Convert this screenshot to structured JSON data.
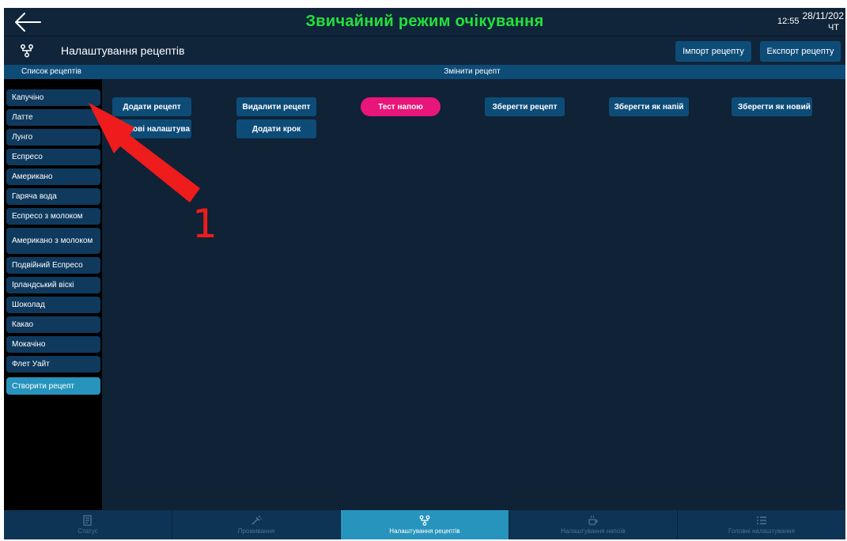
{
  "header": {
    "mode_title": "Звичайний режим очікування",
    "time": "12:55",
    "date": "28/11/202",
    "weekday": "ЧТ"
  },
  "section": {
    "title": "Налаштування рецептів",
    "icon": "recipe-settings-icon",
    "import_label": "Імпорт рецепту",
    "export_label": "Експорт рецепту"
  },
  "subheader": {
    "list_label": "Список рецептів",
    "edit_label": "Змінити рецепт"
  },
  "recipes": [
    "Капучіно",
    "Латте",
    "Лунго",
    "Еспресо",
    "Американо",
    "Гаряча вода",
    "Еспресо з молоком",
    "Американо з молоком",
    "Подвійний Еспресо",
    "Ірландський віскі",
    "Шоколад",
    "Какао",
    "Мокачіно",
    "Флет Уайт"
  ],
  "create_recipe_label": "Створити рецепт",
  "actions": {
    "add_recipe": "Додати рецепт",
    "delete_recipe": "Видалити рецепт",
    "test_drink": "Тест напою",
    "save_recipe": "Зберегти рецепт",
    "save_as_drink": "Зберегти як напій",
    "save_as_new": "Зберегти як новий ре",
    "extra_settings": "атк​ові налаштува",
    "add_step": "Додати крок"
  },
  "tabs": [
    {
      "label": "Статус",
      "icon": "status-icon"
    },
    {
      "label": "Промивання",
      "icon": "rinse-icon"
    },
    {
      "label": "Налаштування рецептів",
      "icon": "recipe-settings-icon"
    },
    {
      "label": "Налаштування напоїв",
      "icon": "cup-icon"
    },
    {
      "label": "Головні налаштування",
      "icon": "list-icon"
    }
  ],
  "annotation": {
    "number": "1"
  },
  "colors": {
    "background": "#0f2236",
    "title_green": "#22e23a",
    "button_blue": "#0e4c78",
    "accent_cyan": "#2794bd",
    "test_pink": "#e8157a",
    "annotation_red": "#ee1c1c"
  }
}
